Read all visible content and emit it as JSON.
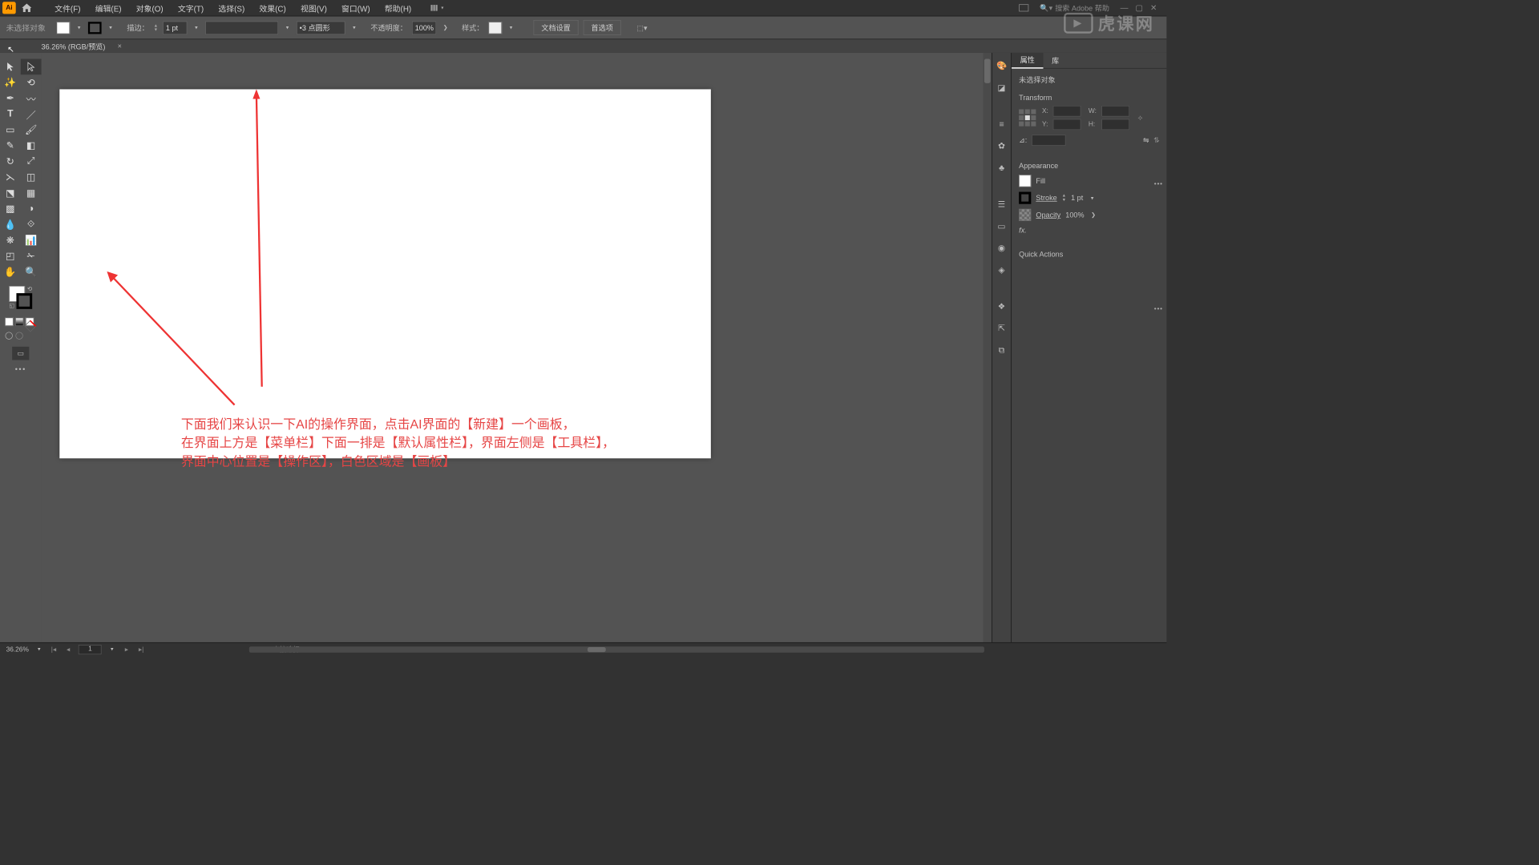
{
  "app": {
    "abbr": "Ai"
  },
  "menu": {
    "file": "文件(F)",
    "edit": "编辑(E)",
    "object": "对象(O)",
    "type": "文字(T)",
    "select": "选择(S)",
    "effect": "效果(C)",
    "view": "视图(V)",
    "window": "窗口(W)",
    "help": "帮助(H)"
  },
  "search": {
    "placeholder": "搜索 Adobe 帮助"
  },
  "ctrl": {
    "nosel": "未选择对象",
    "stroke_label": "描边：",
    "stroke_val": "1 pt",
    "dash_option": "3 点圆形",
    "opacity_label": "不透明度：",
    "opacity_val": "100%",
    "style_label": "样式：",
    "doc_setup": "文档设置",
    "prefs": "首选项"
  },
  "tab": {
    "title": "36.26% (RGB/预览)"
  },
  "status": {
    "zoom": "36.26%",
    "artboard": "1",
    "tool_hint": "直接选择"
  },
  "panel": {
    "props": "属性",
    "lib": "库",
    "nosel": "未选择对象",
    "transform": "Transform",
    "x": "X:",
    "y": "Y:",
    "w": "W:",
    "h": "H:",
    "angle": "⊿:",
    "appearance": "Appearance",
    "fill": "Fill",
    "stroke": "Stroke",
    "stroke_val": "1 pt",
    "opacity": "Opacity",
    "opacity_val": "100%",
    "fx": "fx.",
    "quick": "Quick Actions"
  },
  "tf": {
    "x": "",
    "y": "",
    "w": "",
    "h": ""
  },
  "annot": {
    "l1": "下面我们来认识一下AI的操作界面，点击AI界面的【新建】一个画板，",
    "l2": "在界面上方是【菜单栏】下面一排是【默认属性栏】，界面左侧是【工具栏】，",
    "l3": "界面中心位置是【操作区】，白色区域是【画板】"
  },
  "watermark": {
    "text": "虎课网"
  }
}
